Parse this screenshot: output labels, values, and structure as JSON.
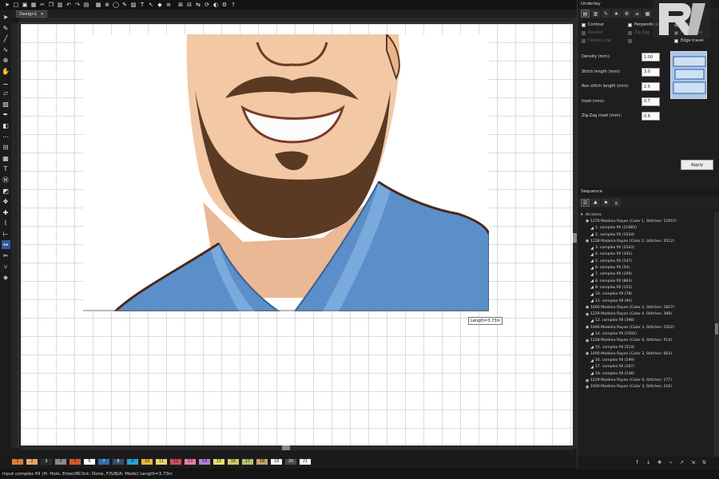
{
  "toolbar": {
    "icons": [
      "select-icon",
      "new-icon",
      "open-icon",
      "save-icon",
      "cut-icon",
      "copy-icon",
      "paste-icon",
      "undo-icon",
      "redo-icon",
      "print-icon",
      "grid-icon",
      "zoom-icon",
      "hoop-icon",
      "stitch-icon",
      "fill-icon",
      "text-icon",
      "pointer-icon",
      "node-icon",
      "align-icon",
      "group-icon",
      "ungroup-icon",
      "mirror-icon",
      "rotate-icon",
      "color-icon",
      "settings-icon",
      "help-icon"
    ]
  },
  "document": {
    "tab_label": "Design1",
    "close_glyph": "×"
  },
  "left_tools": [
    "select-tool",
    "reshape-tool",
    "line-tool",
    "curve-tool",
    "zoom-tool",
    "pan-tool",
    "knife-tool",
    "eraser-tool",
    "fill-tool",
    "color-picker-tool",
    "satin-tool",
    "run-tool",
    "column-tool",
    "complex-fill-tool",
    "lettering-tool",
    "monogram-tool",
    "applique-tool",
    "motif-tool",
    "cross-stitch-tool",
    "trace-tool",
    "ruler-tool",
    "measure-tool",
    "scissors-tool",
    "branch-tool",
    "auto-digitize-tool"
  ],
  "canvas": {
    "length_tooltip": "Length=3.73in"
  },
  "palette": {
    "swatches": [
      {
        "label": "1",
        "color": "#e07a3a"
      },
      {
        "label": "2",
        "color": "#e3a76b"
      },
      {
        "label": "3",
        "color": "#2b2b2b"
      },
      {
        "label": "4",
        "color": "#8a8a8a"
      },
      {
        "label": "5",
        "color": "#d9542b"
      },
      {
        "label": "6",
        "color": "#ffffff"
      },
      {
        "label": "7",
        "color": "#2f6db5"
      },
      {
        "label": "8",
        "color": "#3b4a6b"
      },
      {
        "label": "9",
        "color": "#2aa3c9"
      },
      {
        "label": "10",
        "color": "#f0b53a"
      },
      {
        "label": "11",
        "color": "#f2d56b"
      },
      {
        "label": "12",
        "color": "#d24a5c"
      },
      {
        "label": "13",
        "color": "#e97fa4"
      },
      {
        "label": "14",
        "color": "#b07fd6"
      },
      {
        "label": "15",
        "color": "#e6e36e"
      },
      {
        "label": "16",
        "color": "#d6c86b"
      },
      {
        "label": "17",
        "color": "#b4c46b"
      },
      {
        "label": "18",
        "color": "#c9a06b"
      },
      {
        "label": "19",
        "color": "#f5f5f5"
      },
      {
        "label": "20",
        "color": "#4a4a4a"
      },
      {
        "label": "21",
        "color": "#ffffff"
      }
    ]
  },
  "status": {
    "text": "Input complex fill (H: Hole, Enter/RClick: Done, F/S/B/A: Mode)  Length=3.73in"
  },
  "underlay": {
    "title": "Underlay",
    "checks": [
      {
        "label": "Contour",
        "checked": true,
        "enabled": true
      },
      {
        "label": "Perpendicular",
        "checked": true,
        "enabled": true
      },
      {
        "label": "Lattice",
        "checked": true,
        "enabled": true
      },
      {
        "label": "Parallel",
        "checked": false,
        "enabled": false
      },
      {
        "label": "Zig Zag",
        "checked": false,
        "enabled": false
      },
      {
        "label": "Full Lattice",
        "checked": true,
        "enabled": true
      },
      {
        "label": "Center Line",
        "checked": false,
        "enabled": false
      },
      {
        "label": "",
        "checked": false,
        "enabled": false
      },
      {
        "label": "Edge travel",
        "checked": true,
        "enabled": true
      }
    ],
    "props": [
      {
        "label": "Density (mm):",
        "value": "1.00"
      },
      {
        "label": "Stitch length (mm):",
        "value": "3.0"
      },
      {
        "label": "Run stitch length (mm):",
        "value": "2.5"
      },
      {
        "label": "Inset (mm):",
        "value": "0.7"
      },
      {
        "label": "Zig-Zag inset (mm):",
        "value": "0.6"
      }
    ],
    "apply_label": "Apply"
  },
  "sequence": {
    "title": "Sequence",
    "items": [
      {
        "indent": 0,
        "text": "All items"
      },
      {
        "indent": 1,
        "text": "1270 Madeira Rayon (Color 1, Stitches: 12957)"
      },
      {
        "indent": 2,
        "text": "1. complex fill (11983)"
      },
      {
        "indent": 2,
        "text": "2. complex fill (1034)"
      },
      {
        "indent": 1,
        "text": "1228 Madeira Rayon (Color 2, Stitches: 3512)"
      },
      {
        "indent": 2,
        "text": "3. complex fill (1543)"
      },
      {
        "indent": 2,
        "text": "4. complex fill (341)"
      },
      {
        "indent": 2,
        "text": "5. complex fill (147)"
      },
      {
        "indent": 2,
        "text": "6. complex fill (54)"
      },
      {
        "indent": 2,
        "text": "7. complex fill (109)"
      },
      {
        "indent": 2,
        "text": "8. complex fill (883)"
      },
      {
        "indent": 2,
        "text": "9. complex fill (152)"
      },
      {
        "indent": 2,
        "text": "10. complex fill (78)"
      },
      {
        "indent": 2,
        "text": "11. complex fill (90)"
      },
      {
        "indent": 1,
        "text": "1000 Madeira Rayon (Color 3, Stitches: 1827)"
      },
      {
        "indent": 1,
        "text": "1229 Madeira Rayon (Color 4, Stitches: 398)"
      },
      {
        "indent": 2,
        "text": "12. complex fill (398)"
      },
      {
        "indent": 1,
        "text": "1000 Madeira Rayon (Color 3, Stitches: 1502)"
      },
      {
        "indent": 2,
        "text": "14. complex fill (1502)"
      },
      {
        "indent": 1,
        "text": "1228 Madeira Rayon (Color 4, Stitches: 514)"
      },
      {
        "indent": 2,
        "text": "15. complex fill (514)"
      },
      {
        "indent": 1,
        "text": "1000 Madeira Rayon (Color 3, Stitches: 603)"
      },
      {
        "indent": 2,
        "text": "16. complex fill (199)"
      },
      {
        "indent": 2,
        "text": "17. complex fill (167)"
      },
      {
        "indent": 2,
        "text": "18. complex fill (238)"
      },
      {
        "indent": 1,
        "text": "1229 Madeira Rayon (Color 4, Stitches: 177)"
      },
      {
        "indent": 1,
        "text": "1000 Madeira Rayon (Color 3, Stitches: 216)"
      }
    ]
  },
  "colors": {
    "accent": "#2d5e9e",
    "canvas_bg": "#ffffff",
    "panel_bg": "#1e1e1e",
    "shirt": "#5b8fc9",
    "skin": "#f2c8a5",
    "beard": "#5a3a22"
  }
}
